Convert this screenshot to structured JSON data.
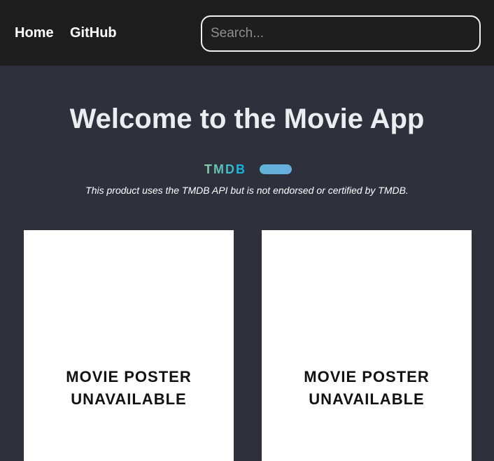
{
  "nav": {
    "home_label": "Home",
    "github_label": "GitHub"
  },
  "search": {
    "placeholder": "Search...",
    "value": ""
  },
  "hero": {
    "title": "Welcome to the Movie App",
    "attribution_logo": "TMDB",
    "disclaimer": "This product uses the TMDB API but is not endorsed or certified by TMDB."
  },
  "colors": {
    "header_bg": "#1e1e1e",
    "page_bg": "#2e303c",
    "tmdb_green": "#90cea1",
    "tmdb_blue": "#01b4e4"
  },
  "movies": [
    {
      "poster_line1": "MOVIE POSTER",
      "poster_line2": "UNAVAILABLE"
    },
    {
      "poster_line1": "MOVIE POSTER",
      "poster_line2": "UNAVAILABLE"
    }
  ]
}
